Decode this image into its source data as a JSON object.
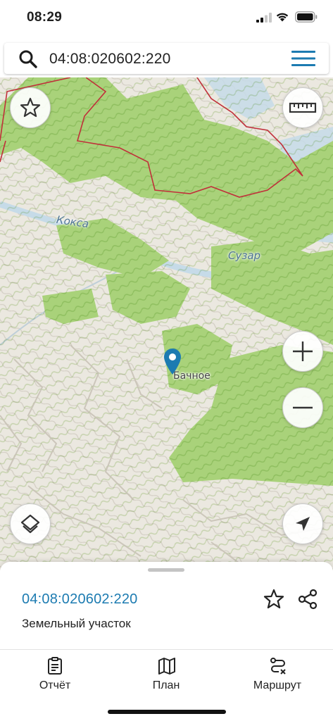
{
  "status_bar": {
    "time": "08:29",
    "icons": [
      "cellular-signal-icon",
      "wifi-icon",
      "battery-icon"
    ]
  },
  "search": {
    "query": "04:08:020602:220",
    "search_icon": "search-icon",
    "menu_icon": "hamburger-menu-icon"
  },
  "map": {
    "labels": {
      "river": "Кокса",
      "village_north": "Сузар",
      "village_pin": "Бачное"
    },
    "controls": {
      "favorite": "star-icon",
      "ruler": "ruler-icon",
      "zoom_in": "plus-icon",
      "zoom_out": "minus-icon",
      "layers": "layers-icon",
      "locate": "navigation-arrow-icon"
    },
    "colors": {
      "forest": "#a9d27a",
      "terrain": "#ebe8e0",
      "water": "#c6dbe8",
      "boundary": "#c0303a",
      "pin": "#1c7bb1"
    }
  },
  "sheet": {
    "parcel_id": "04:08:020602:220",
    "parcel_type": "Земельный участок",
    "accent_color": "#1c7bb1"
  },
  "tabs": [
    {
      "label": "Отчёт",
      "icon": "clipboard-report-icon"
    },
    {
      "label": "План",
      "icon": "map-plan-icon"
    },
    {
      "label": "Маршрут",
      "icon": "route-icon"
    }
  ]
}
